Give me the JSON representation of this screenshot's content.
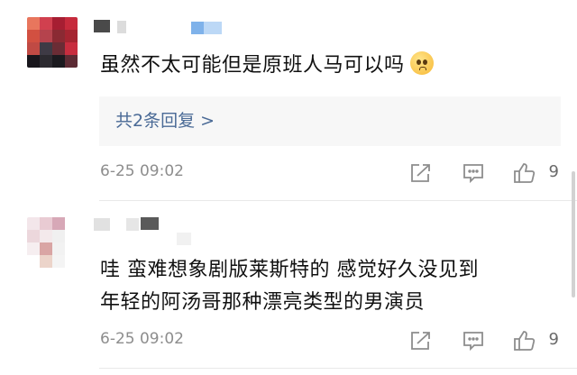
{
  "comments": [
    {
      "content": "虽然不太可能但是原班人马可以吗",
      "emoji": "pleading-face",
      "replies_label": "共2条回复 >",
      "time": "6-25 09:02",
      "likes": "9"
    },
    {
      "content_line1": "哇 蛮难想象剧版莱斯特的 感觉好久没见到",
      "content_line2": "年轻的阿汤哥那种漂亮类型的男演员",
      "time": "6-25 09:02",
      "likes": "9"
    }
  ],
  "icons": {
    "share": "share-icon",
    "comment": "comment-icon",
    "like": "thumbs-up-icon"
  },
  "colors": {
    "link": "#4a6a96",
    "meta": "#8d8d8d",
    "reply_bg": "#f7f7f7"
  }
}
